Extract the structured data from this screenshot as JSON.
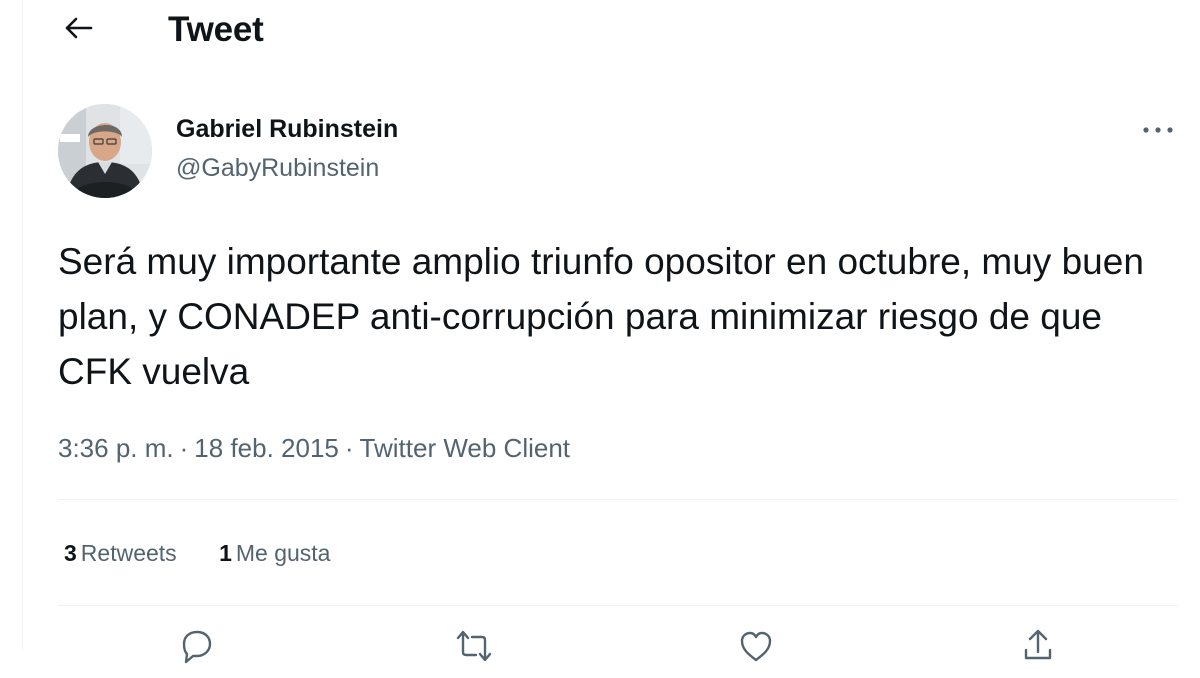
{
  "header": {
    "title": "Tweet"
  },
  "tweet": {
    "author": {
      "display_name": "Gabriel Rubinstein",
      "handle": "@GabyRubinstein"
    },
    "text": "Será muy importante amplio triunfo opositor en octubre, muy buen plan, y CONADEP anti-corrupción para minimizar riesgo de que CFK vuelva",
    "time": "3:36 p. m.",
    "date": "18 feb. 2015",
    "separator": "·",
    "client": "Twitter Web Client",
    "stats": {
      "retweets_count": "3",
      "retweets_label": "Retweets",
      "likes_count": "1",
      "likes_label": "Me gusta"
    }
  },
  "icons": {
    "back": "arrow-left-icon",
    "more": "more-horizontal-icon",
    "reply": "reply-icon",
    "retweet": "retweet-icon",
    "like": "heart-icon",
    "share": "share-icon"
  },
  "colors": {
    "text_primary": "#0f1419",
    "text_secondary": "#536471",
    "divider": "#eff3f4",
    "background": "#ffffff"
  }
}
